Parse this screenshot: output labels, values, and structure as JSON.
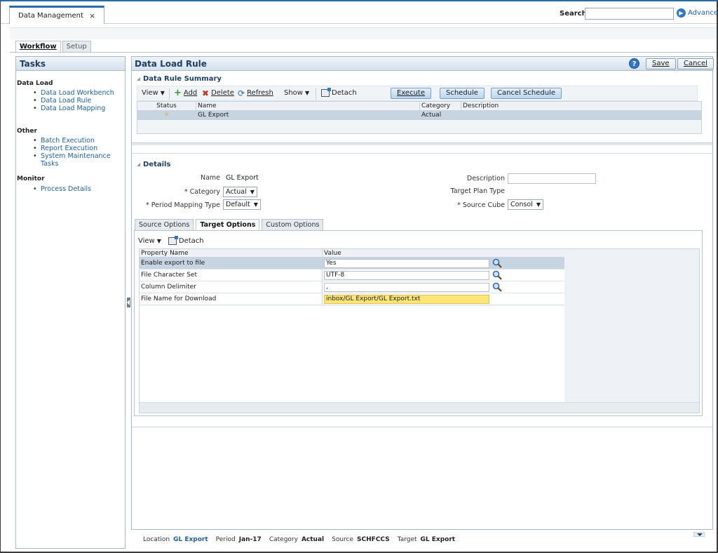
{
  "window": {
    "tab_title": "Data Management",
    "tab_close": "×"
  },
  "search": {
    "label": "Search:",
    "value": "",
    "advanced": "Advanced"
  },
  "workflow_tabs": [
    {
      "label": "Workflow",
      "active": true
    },
    {
      "label": "Setup",
      "active": false
    }
  ],
  "tasks": {
    "title": "Tasks",
    "groups": [
      {
        "name": "Data Load",
        "items": [
          "Data Load Workbench",
          "Data Load Rule",
          "Data Load Mapping"
        ]
      },
      {
        "name": "Other",
        "items": [
          "Batch Execution",
          "Report Execution",
          "System Maintenance Tasks"
        ]
      },
      {
        "name": "Monitor",
        "items": [
          "Process Details"
        ]
      }
    ]
  },
  "main": {
    "title": "Data Load Rule",
    "help": "?",
    "save_label": "Save",
    "cancel_label": "Cancel"
  },
  "summary": {
    "title": "Data Rule Summary",
    "toolbar": {
      "view": "View",
      "add": "Add",
      "delete": "Delete",
      "refresh": "Refresh",
      "show": "Show",
      "detach": "Detach",
      "execute": "Execute",
      "schedule": "Schedule",
      "cancel_schedule": "Cancel Schedule"
    },
    "columns": [
      "Status",
      "Name",
      "Category",
      "Description"
    ],
    "rows": [
      {
        "status": "☼",
        "name": "GL Export",
        "category": "Actual",
        "description": ""
      }
    ]
  },
  "details": {
    "title": "Details",
    "name_label": "Name",
    "name_value": "GL Export",
    "category_label": "* Category",
    "category_value": "Actual",
    "period_label": "* Period Mapping Type",
    "period_value": "Default",
    "description_label": "Description",
    "description_value": "",
    "target_plan_label": "Target Plan Type",
    "source_cube_label": "* Source Cube",
    "source_cube_value": "Consol"
  },
  "option_tabs": [
    {
      "label": "Source Options",
      "active": false
    },
    {
      "label": "Target Options",
      "active": true
    },
    {
      "label": "Custom Options",
      "active": false
    }
  ],
  "target_options": {
    "view": "View",
    "detach": "Detach",
    "columns": [
      "Property Name",
      "Value"
    ],
    "rows": [
      {
        "property": "Enable export to file",
        "value": "Yes",
        "selected": true,
        "highlight": false,
        "lookup": true
      },
      {
        "property": "File Character Set",
        "value": "UTF-8",
        "selected": false,
        "highlight": false,
        "lookup": true
      },
      {
        "property": "Column Delimiter",
        "value": ",",
        "selected": false,
        "highlight": false,
        "lookup": true
      },
      {
        "property": "File Name for Download",
        "value": "inbox/GL Export/GL Export.txt",
        "selected": false,
        "highlight": true,
        "lookup": false
      }
    ]
  },
  "status_bar": {
    "location_label": "Location",
    "location_value": "GL Export",
    "period_label": "Period",
    "period_value": "Jan-17",
    "category_label": "Category",
    "category_value": "Actual",
    "source_label": "Source",
    "source_value": "SCHFCCS",
    "target_label": "Target",
    "target_value": "GL Export"
  },
  "colors": {
    "accent": "#2a6ca8",
    "selection": "#c7d4e1",
    "highlight_field": "#fde57a",
    "header_text": "#1e3f64"
  }
}
